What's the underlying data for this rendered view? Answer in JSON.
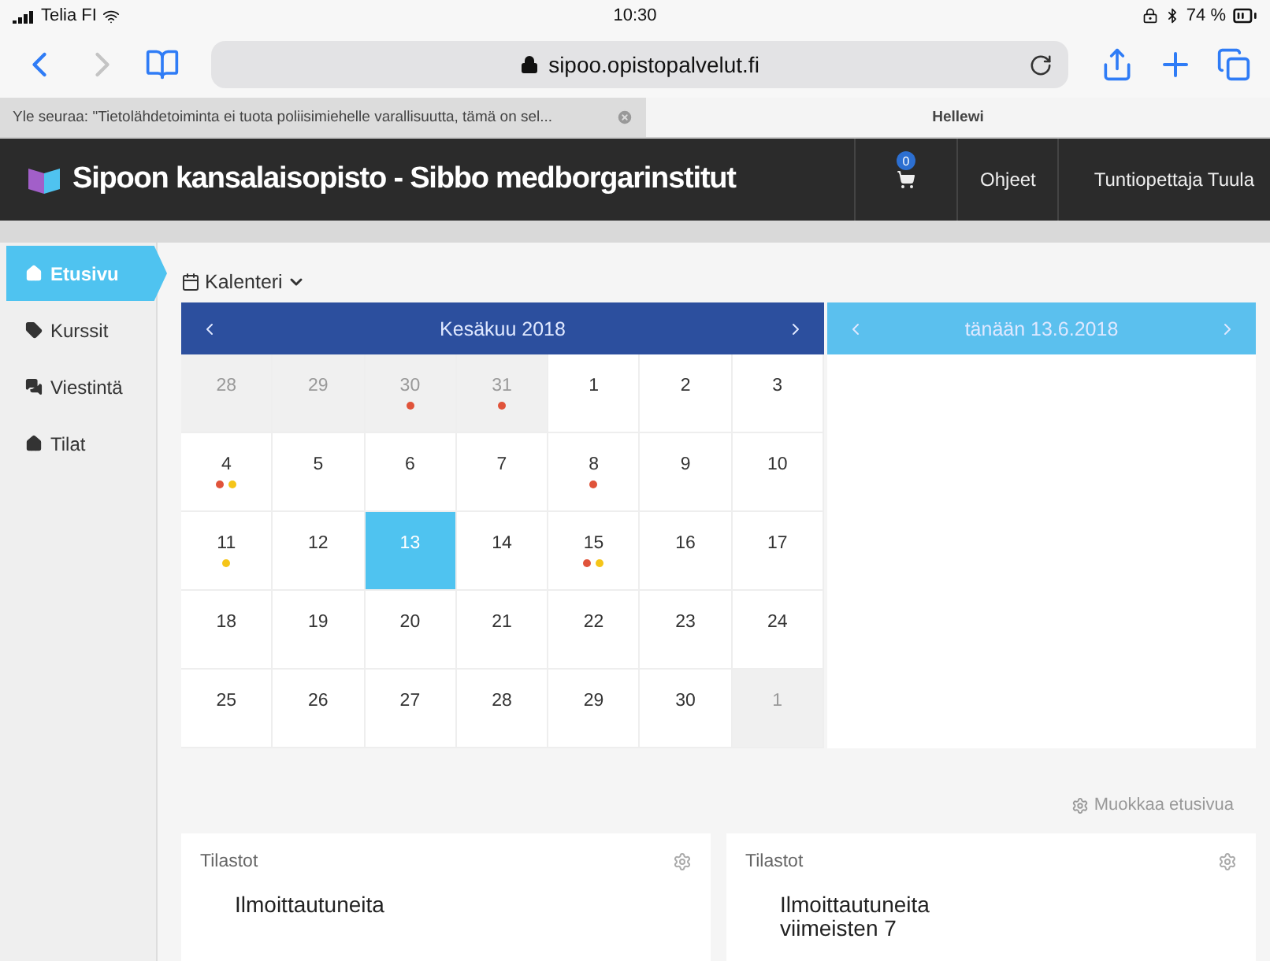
{
  "status_bar": {
    "carrier": "Telia FI",
    "time": "10:30",
    "battery": "74 %"
  },
  "browser": {
    "url": "sipoo.opistopalvelut.fi",
    "tabs": [
      {
        "title": "Yle seuraa: \"Tietolähdetoiminta ei tuota poliisimiehelle varallisuutta, tämä on sel...",
        "selected": false
      },
      {
        "title": "Hellewi",
        "selected": true
      }
    ]
  },
  "header": {
    "title": "Sipoon kansalaisopisto - Sibbo medborgarinstitut",
    "cart_count": "0",
    "links": [
      "Ohjeet",
      "Tuntiopettaja Tuula"
    ]
  },
  "sidebar": {
    "items": [
      {
        "label": "Etusivu",
        "kind": "home",
        "selected": true
      },
      {
        "label": "Kurssit",
        "kind": "tag",
        "selected": false
      },
      {
        "label": "Viestintä",
        "kind": "chat",
        "selected": false
      },
      {
        "label": "Tilat",
        "kind": "home",
        "selected": false
      }
    ]
  },
  "calendar": {
    "view": "Kalenteri",
    "month": "Kesäkuu 2018",
    "today": "tänään 13.6.2018",
    "weeks": [
      [
        {
          "day": "28",
          "muted": true,
          "selected": false
        },
        {
          "day": "29",
          "muted": true,
          "selected": false
        },
        {
          "day": "30",
          "muted": true,
          "selected": false,
          "dots": [
            {
              "color": "#e0533a"
            }
          ]
        },
        {
          "day": "31",
          "muted": true,
          "selected": false,
          "dots": [
            {
              "color": "#e0533a"
            }
          ]
        },
        {
          "day": "1",
          "muted": false,
          "selected": false
        },
        {
          "day": "2",
          "muted": false,
          "selected": false
        },
        {
          "day": "3",
          "muted": false,
          "selected": false
        }
      ],
      [
        {
          "day": "4",
          "muted": false,
          "selected": false,
          "dots": [
            {
              "color": "#e0533a"
            },
            {
              "color": "#f5c518"
            }
          ]
        },
        {
          "day": "5",
          "muted": false,
          "selected": false
        },
        {
          "day": "6",
          "muted": false,
          "selected": false
        },
        {
          "day": "7",
          "muted": false,
          "selected": false
        },
        {
          "day": "8",
          "muted": false,
          "selected": false,
          "dots": [
            {
              "color": "#e0533a"
            }
          ]
        },
        {
          "day": "9",
          "muted": false,
          "selected": false
        },
        {
          "day": "10",
          "muted": false,
          "selected": false
        }
      ],
      [
        {
          "day": "11",
          "muted": false,
          "selected": false,
          "dots": [
            {
              "color": "#f5c518"
            }
          ]
        },
        {
          "day": "12",
          "muted": false,
          "selected": false
        },
        {
          "day": "13",
          "muted": false,
          "selected": true
        },
        {
          "day": "14",
          "muted": false,
          "selected": false
        },
        {
          "day": "15",
          "muted": false,
          "selected": false,
          "dots": [
            {
              "color": "#e0533a"
            },
            {
              "color": "#f5c518"
            }
          ]
        },
        {
          "day": "16",
          "muted": false,
          "selected": false
        },
        {
          "day": "17",
          "muted": false,
          "selected": false
        }
      ],
      [
        {
          "day": "18",
          "muted": false,
          "selected": false
        },
        {
          "day": "19",
          "muted": false,
          "selected": false
        },
        {
          "day": "20",
          "muted": false,
          "selected": false
        },
        {
          "day": "21",
          "muted": false,
          "selected": false
        },
        {
          "day": "22",
          "muted": false,
          "selected": false
        },
        {
          "day": "23",
          "muted": false,
          "selected": false
        },
        {
          "day": "24",
          "muted": false,
          "selected": false
        }
      ],
      [
        {
          "day": "25",
          "muted": false,
          "selected": false
        },
        {
          "day": "26",
          "muted": false,
          "selected": false
        },
        {
          "day": "27",
          "muted": false,
          "selected": false
        },
        {
          "day": "28",
          "muted": false,
          "selected": false
        },
        {
          "day": "29",
          "muted": false,
          "selected": false
        },
        {
          "day": "30",
          "muted": false,
          "selected": false
        },
        {
          "day": "1",
          "muted": true,
          "selected": false
        }
      ]
    ]
  },
  "edit_link": "Muokkaa etusivua",
  "cards": [
    {
      "title": "Tilastot",
      "lines": [
        "Ilmoittautuneita"
      ]
    },
    {
      "title": "Tilastot",
      "lines": [
        "Ilmoittautuneita",
        "viimeisten 7"
      ]
    }
  ]
}
